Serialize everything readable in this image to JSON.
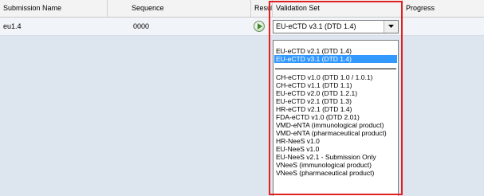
{
  "columns": {
    "submission_name": "Submission Name",
    "sequence": "Sequence",
    "result": "Result",
    "validation_set": "Validation Set",
    "progress": "Progress"
  },
  "row": {
    "submission_name": "eu1.4",
    "sequence": "0000",
    "validation_set": "EU-eCTD v3.1 (DTD 1.4)"
  },
  "dropdown": {
    "recent": [
      "EU-eCTD v2.1 (DTD 1.4)",
      "EU-eCTD v3.1 (DTD 1.4)"
    ],
    "selected": "EU-eCTD v3.1 (DTD 1.4)",
    "all": [
      "CH-eCTD v1.0 (DTD 1.0 / 1.0.1)",
      "CH-eCTD v1.1 (DTD 1.1)",
      "EU-eCTD v2.0 (DTD 1.2.1)",
      "EU-eCTD v2.1 (DTD 1.3)",
      "HR-eCTD v2.1 (DTD 1.4)",
      "FDA-eCTD v1.0 (DTD 2.01)",
      "VMD-eNTA (immunological product)",
      "VMD-eNTA (pharmaceutical product)",
      "HR-NeeS v1.0",
      "EU-NeeS v1.0",
      "EU-NeeS v2.1 - Submission Only",
      "VNeeS (immunological product)",
      "VNeeS (pharmaceutical product)"
    ]
  },
  "colors": {
    "highlight": "#e32020",
    "selection": "#3399ff"
  },
  "icons": [
    "play-icon",
    "chevron-down-icon"
  ]
}
